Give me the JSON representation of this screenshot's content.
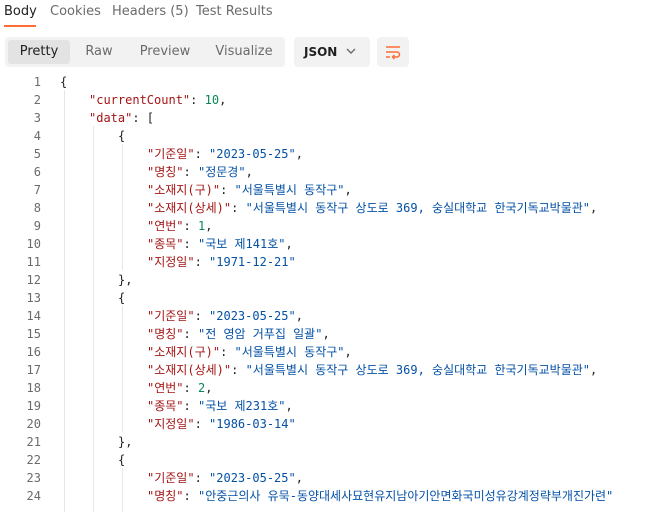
{
  "tabs": [
    {
      "label": "Body"
    },
    {
      "label": "Cookies"
    },
    {
      "label": "Headers (5)"
    },
    {
      "label": "Test Results"
    }
  ],
  "view_modes": [
    {
      "label": "Pretty"
    },
    {
      "label": "Raw"
    },
    {
      "label": "Preview"
    },
    {
      "label": "Visualize"
    }
  ],
  "format": {
    "selected": "JSON"
  },
  "icons": {
    "format_dropdown": "chevron-down-icon",
    "wrap": "wrap-lines-icon"
  },
  "colors": {
    "accent": "#ff6c37",
    "key": "#a31515",
    "string": "#0451a5",
    "number": "#098658"
  },
  "code_lines": [
    {
      "num": "1",
      "indent": 0,
      "tokens": [
        {
          "t": "{",
          "c": "p"
        }
      ]
    },
    {
      "num": "2",
      "indent": 1,
      "tokens": [
        {
          "t": "\"currentCount\"",
          "c": "k"
        },
        {
          "t": ": ",
          "c": "p"
        },
        {
          "t": "10",
          "c": "n"
        },
        {
          "t": ",",
          "c": "p"
        }
      ]
    },
    {
      "num": "3",
      "indent": 1,
      "tokens": [
        {
          "t": "\"data\"",
          "c": "k"
        },
        {
          "t": ": [",
          "c": "p"
        }
      ]
    },
    {
      "num": "4",
      "indent": 2,
      "tokens": [
        {
          "t": "{",
          "c": "p"
        }
      ]
    },
    {
      "num": "5",
      "indent": 3,
      "tokens": [
        {
          "t": "\"기준일\"",
          "c": "k"
        },
        {
          "t": ": ",
          "c": "p"
        },
        {
          "t": "\"2023-05-25\"",
          "c": "s"
        },
        {
          "t": ",",
          "c": "p"
        }
      ]
    },
    {
      "num": "6",
      "indent": 3,
      "tokens": [
        {
          "t": "\"명칭\"",
          "c": "k"
        },
        {
          "t": ": ",
          "c": "p"
        },
        {
          "t": "\"정문경\"",
          "c": "s"
        },
        {
          "t": ",",
          "c": "p"
        }
      ]
    },
    {
      "num": "7",
      "indent": 3,
      "tokens": [
        {
          "t": "\"소재지(구)\"",
          "c": "k"
        },
        {
          "t": ": ",
          "c": "p"
        },
        {
          "t": "\"서울특별시 동작구\"",
          "c": "s"
        },
        {
          "t": ",",
          "c": "p"
        }
      ]
    },
    {
      "num": "8",
      "indent": 3,
      "tokens": [
        {
          "t": "\"소재지(상세)\"",
          "c": "k"
        },
        {
          "t": ": ",
          "c": "p"
        },
        {
          "t": "\"서울특별시 동작구 상도로 369, 숭실대학교 한국기독교박물관\"",
          "c": "s"
        },
        {
          "t": ",",
          "c": "p"
        }
      ]
    },
    {
      "num": "9",
      "indent": 3,
      "tokens": [
        {
          "t": "\"연번\"",
          "c": "k"
        },
        {
          "t": ": ",
          "c": "p"
        },
        {
          "t": "1",
          "c": "n"
        },
        {
          "t": ",",
          "c": "p"
        }
      ]
    },
    {
      "num": "10",
      "indent": 3,
      "tokens": [
        {
          "t": "\"종목\"",
          "c": "k"
        },
        {
          "t": ": ",
          "c": "p"
        },
        {
          "t": "\"국보 제141호\"",
          "c": "s"
        },
        {
          "t": ",",
          "c": "p"
        }
      ]
    },
    {
      "num": "11",
      "indent": 3,
      "tokens": [
        {
          "t": "\"지정일\"",
          "c": "k"
        },
        {
          "t": ": ",
          "c": "p"
        },
        {
          "t": "\"1971-12-21\"",
          "c": "s"
        }
      ]
    },
    {
      "num": "12",
      "indent": 2,
      "tokens": [
        {
          "t": "},",
          "c": "p"
        }
      ]
    },
    {
      "num": "13",
      "indent": 2,
      "tokens": [
        {
          "t": "{",
          "c": "p"
        }
      ]
    },
    {
      "num": "14",
      "indent": 3,
      "tokens": [
        {
          "t": "\"기준일\"",
          "c": "k"
        },
        {
          "t": ": ",
          "c": "p"
        },
        {
          "t": "\"2023-05-25\"",
          "c": "s"
        },
        {
          "t": ",",
          "c": "p"
        }
      ]
    },
    {
      "num": "15",
      "indent": 3,
      "tokens": [
        {
          "t": "\"명칭\"",
          "c": "k"
        },
        {
          "t": ": ",
          "c": "p"
        },
        {
          "t": "\"전 영암 거푸집 일괄\"",
          "c": "s"
        },
        {
          "t": ",",
          "c": "p"
        }
      ]
    },
    {
      "num": "16",
      "indent": 3,
      "tokens": [
        {
          "t": "\"소재지(구)\"",
          "c": "k"
        },
        {
          "t": ": ",
          "c": "p"
        },
        {
          "t": "\"서울특별시 동작구\"",
          "c": "s"
        },
        {
          "t": ",",
          "c": "p"
        }
      ]
    },
    {
      "num": "17",
      "indent": 3,
      "tokens": [
        {
          "t": "\"소재지(상세)\"",
          "c": "k"
        },
        {
          "t": ": ",
          "c": "p"
        },
        {
          "t": "\"서울특별시 동작구 상도로 369, 숭실대학교 한국기독교박물관\"",
          "c": "s"
        },
        {
          "t": ",",
          "c": "p"
        }
      ]
    },
    {
      "num": "18",
      "indent": 3,
      "tokens": [
        {
          "t": "\"연번\"",
          "c": "k"
        },
        {
          "t": ": ",
          "c": "p"
        },
        {
          "t": "2",
          "c": "n"
        },
        {
          "t": ",",
          "c": "p"
        }
      ]
    },
    {
      "num": "19",
      "indent": 3,
      "tokens": [
        {
          "t": "\"종목\"",
          "c": "k"
        },
        {
          "t": ": ",
          "c": "p"
        },
        {
          "t": "\"국보 제231호\"",
          "c": "s"
        },
        {
          "t": ",",
          "c": "p"
        }
      ]
    },
    {
      "num": "20",
      "indent": 3,
      "tokens": [
        {
          "t": "\"지정일\"",
          "c": "k"
        },
        {
          "t": ": ",
          "c": "p"
        },
        {
          "t": "\"1986-03-14\"",
          "c": "s"
        }
      ]
    },
    {
      "num": "21",
      "indent": 2,
      "tokens": [
        {
          "t": "},",
          "c": "p"
        }
      ]
    },
    {
      "num": "22",
      "indent": 2,
      "tokens": [
        {
          "t": "{",
          "c": "p"
        }
      ]
    },
    {
      "num": "23",
      "indent": 3,
      "tokens": [
        {
          "t": "\"기준일\"",
          "c": "k"
        },
        {
          "t": ": ",
          "c": "p"
        },
        {
          "t": "\"2023-05-25\"",
          "c": "s"
        },
        {
          "t": ",",
          "c": "p"
        }
      ]
    },
    {
      "num": "24",
      "indent": 3,
      "tokens": [
        {
          "t": "\"명칭\"",
          "c": "k"
        },
        {
          "t": ": ",
          "c": "p"
        },
        {
          "t": "\"안중근의사 유묵-동양대세사묘현유지남아기안면화국미성유강계정략부개진가련\"",
          "c": "s"
        }
      ]
    }
  ]
}
